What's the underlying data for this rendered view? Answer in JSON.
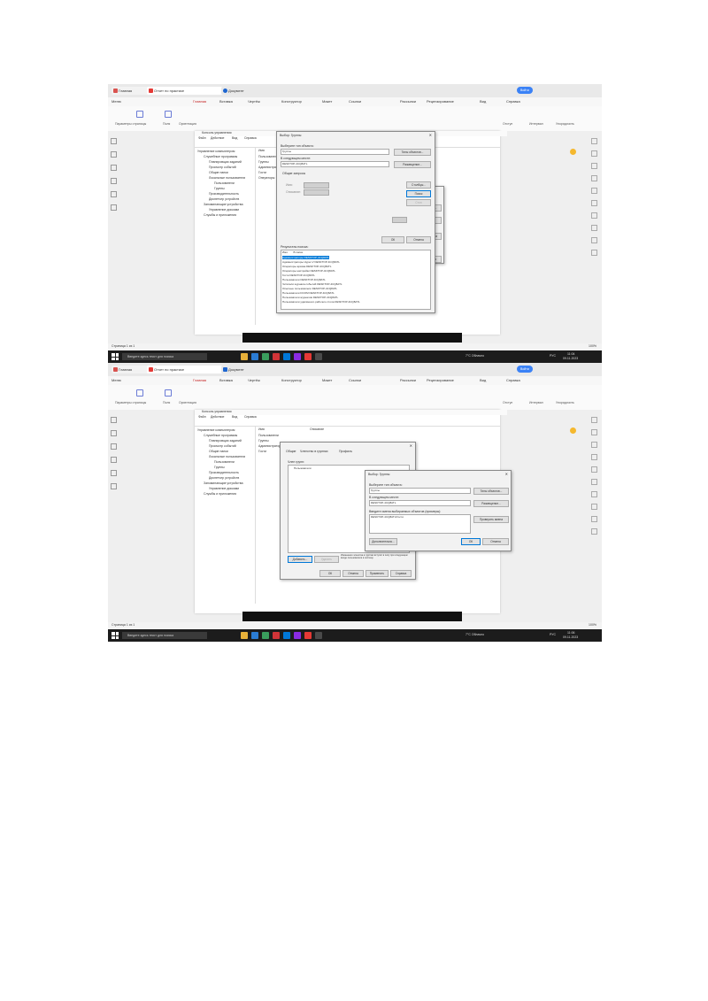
{
  "browser": {
    "tabs": [
      {
        "label": "Главная",
        "icon": "app-icon",
        "color": "#d9534f"
      },
      {
        "label": "Отчет по практике",
        "icon": "pdf-icon",
        "color": "#e53935"
      },
      {
        "label": "Документ",
        "icon": "doc-icon",
        "color": "#1e66d0"
      }
    ],
    "sign_in_label": "Войти"
  },
  "editor": {
    "menu": [
      "Меню",
      "Главная",
      "Вставка",
      "Чертёж",
      "Конструктор",
      "Макет",
      "Ссылки",
      "Рассылки",
      "Рецензирование",
      "Вид",
      "Справка"
    ],
    "ribbon": [
      "Параметры страницы",
      "Поля",
      "Ориентация",
      "Размер",
      "Колонки",
      "Разрывы",
      "Отступ",
      "Интервал",
      "Упорядочить"
    ],
    "status_left": "Страница 1 из 1",
    "status_right": "100%"
  },
  "mmc": {
    "title": "Консоль управления",
    "menu": [
      "Файл",
      "Действие",
      "Вид",
      "Справка"
    ],
    "tree": [
      "Управление компьютером",
      "Служебные программы",
      "Планировщик заданий",
      "Просмотр событий",
      "Общие папки",
      "Локальные пользователи",
      "Пользователи",
      "Группы",
      "Производительность",
      "Диспетчер устройств",
      "Запоминающие устройства",
      "Управление дисками",
      "Службы и приложения"
    ],
    "panel_items": [
      "Пользователи",
      "Группы",
      "Администраторы",
      "Гости",
      "Операторы",
      "Пользователи удалённого"
    ],
    "panel_headers": [
      "Имя",
      "Описание"
    ]
  },
  "dialog_select_groups": {
    "title": "Выбор: Группы",
    "object_type_label": "Выберите тип объекта:",
    "object_type_value": "Группы",
    "object_types_button": "Типы объектов...",
    "location_label": "В следующем месте:",
    "location_value": "DESKTOP-4CQ8ATL",
    "locations_button": "Размещение...",
    "common_queries_tab": "Общие запросы",
    "name_label": "Имя:",
    "description_label": "Описание:",
    "columns_button": "Столбцы...",
    "find_button": "Поиск",
    "stop_button": "Стоп",
    "ok_button": "ОК",
    "cancel_button": "Отмена",
    "results_label": "Результаты поиска:",
    "results_headers": [
      "Имя",
      "В папке"
    ],
    "results": [
      {
        "name": "Администраторы",
        "folder": "DESKTOP-4CQ8ATL"
      },
      {
        "name": "Администраторы Hyper-V",
        "folder": "DESKTOP-4CQ8ATL"
      },
      {
        "name": "Операторы архива",
        "folder": "DESKTOP-4CQ8ATL"
      },
      {
        "name": "Операторы настройки",
        "folder": "DESKTOP-4CQ8ATL"
      },
      {
        "name": "Гости",
        "folder": "DESKTOP-4CQ8ATL"
      },
      {
        "name": "Пользователи",
        "folder": "DESKTOP-4CQ8ATL"
      },
      {
        "name": "Читатели журнала событий",
        "folder": "DESKTOP-4CQ8ATL"
      },
      {
        "name": "Опытные пользователи",
        "folder": "DESKTOP-4CQ8ATL"
      },
      {
        "name": "Пользователи DCOM",
        "folder": "DESKTOP-4CQ8ATL"
      },
      {
        "name": "Пользователи журналов",
        "folder": "DESKTOP-4CQ8ATL"
      },
      {
        "name": "Пользователи удалённого рабочего стола",
        "folder": "DESKTOP-4CQ8ATL"
      }
    ]
  },
  "dialog_behind": {
    "button1": "Типы объектов...",
    "button2": "Размещение...",
    "button3": "Проверить имена",
    "button4": "Отмена"
  },
  "dialog_properties": {
    "tabs": [
      "Общие",
      "Членство в группах",
      "Профиль"
    ],
    "member_label": "Член групп:",
    "member_item": "Пользователи",
    "add_button": "Добавить...",
    "remove_button": "Удалить",
    "note": "Изменения членства в группах вступят в силу при следующем входе пользователя в систему.",
    "ok": "ОК",
    "cancel": "Отмена",
    "apply": "Применить",
    "help": "Справка"
  },
  "dialog_select_group2": {
    "title": "Выбор: Группы",
    "object_type_label": "Выберите тип объекта:",
    "object_type_value": "Группы",
    "object_types_button": "Типы объектов...",
    "location_label": "В следующем месте:",
    "location_value": "DESKTOP-4CQ8ATL",
    "locations_button": "Размещение...",
    "names_label": "Введите имена выбираемых объектов (примеры):",
    "names_value": "DESKTOP-4CQ8ATL\\Гости",
    "check_names_button": "Проверить имена",
    "advanced_button": "Дополнительно...",
    "ok": "ОК",
    "cancel": "Отмена"
  },
  "taskbar": {
    "search_placeholder": "Введите здесь текст для поиска",
    "weather": "7°C Облачно",
    "lang": "РУС",
    "time1": "11:04",
    "date1": "09.11.2023",
    "time2": "11:06",
    "date2": "09.11.2023"
  },
  "colors": {
    "accent": "#0078d7",
    "taskbar": "#1c1c1c",
    "pdf_red": "#e53935"
  }
}
